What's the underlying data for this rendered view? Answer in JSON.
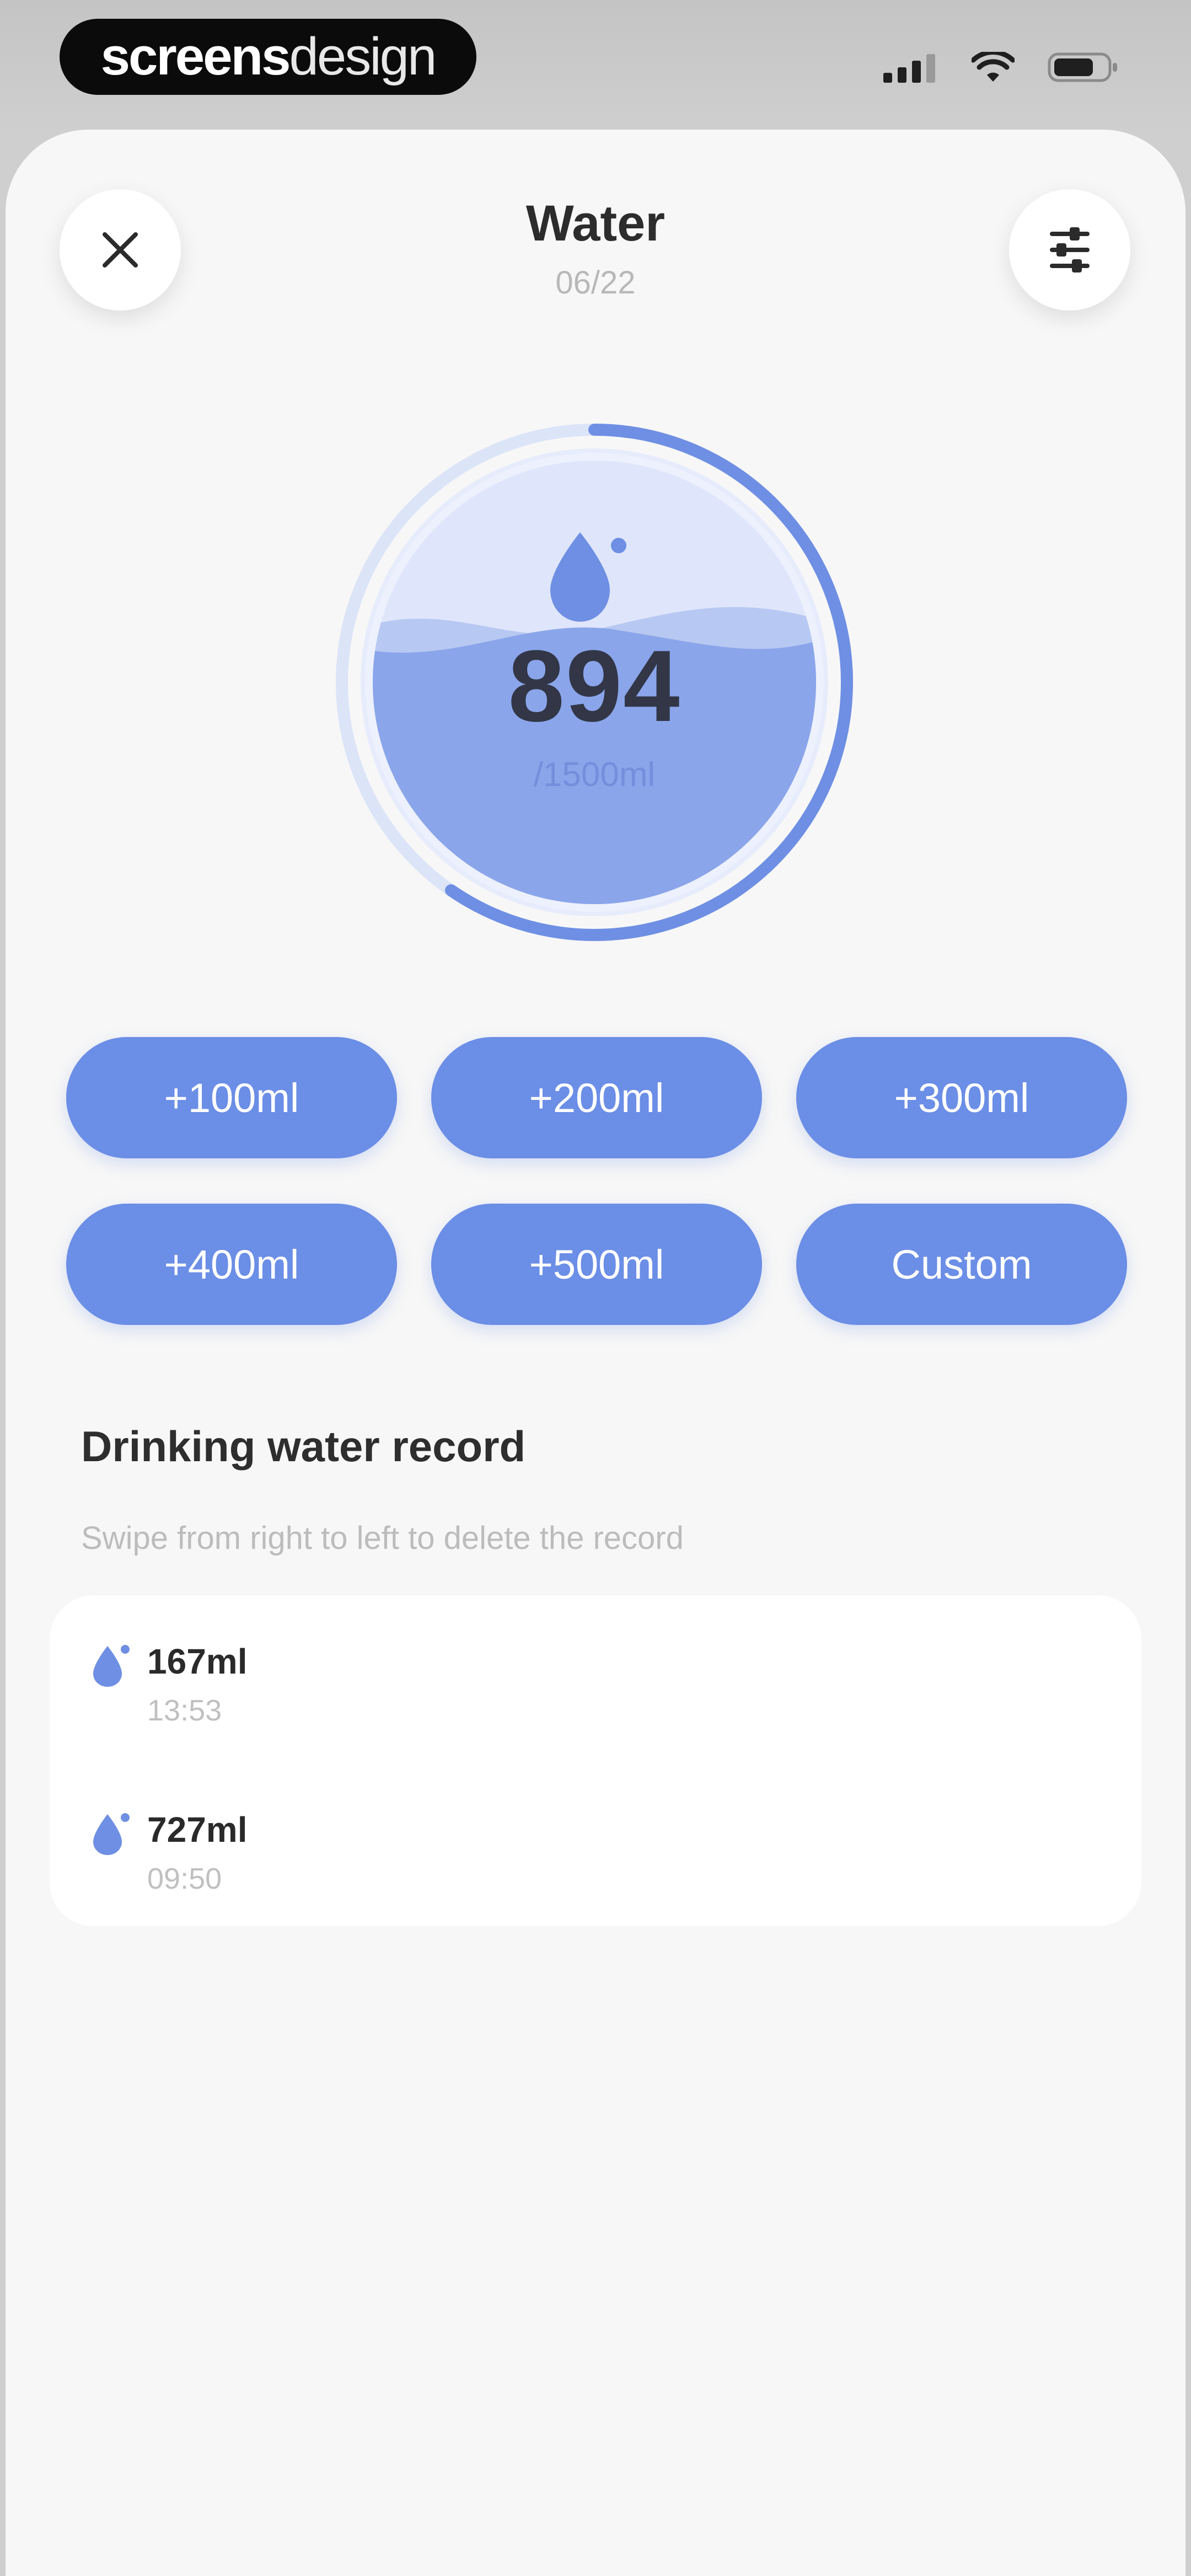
{
  "status_bar": {
    "watermark_bold": "screens",
    "watermark_light": "design",
    "signal_icon": "cellular-signal-icon",
    "wifi_icon": "wifi-icon",
    "battery_icon": "battery-icon"
  },
  "header": {
    "title": "Water",
    "date": "06/22",
    "close_icon": "close-icon",
    "settings_icon": "sliders-icon"
  },
  "gauge": {
    "value": "894",
    "goal_label": "/1500ml",
    "progress_fraction": 0.596,
    "icon": "water-drop-icon"
  },
  "quick_add": {
    "buttons": [
      {
        "label": "+100ml"
      },
      {
        "label": "+200ml"
      },
      {
        "label": "+300ml"
      },
      {
        "label": "+400ml"
      },
      {
        "label": "+500ml"
      },
      {
        "label": "Custom"
      }
    ]
  },
  "records": {
    "title": "Drinking water record",
    "hint": "Swipe from right to left to delete the record",
    "items": [
      {
        "amount": "167ml",
        "time": "13:53"
      },
      {
        "amount": "727ml",
        "time": "09:50"
      }
    ]
  },
  "colors": {
    "accent": "#6b8ee6",
    "water_dark": "#8aa5ea",
    "water_light": "#dfe6fb",
    "background": "#f7f7f7"
  }
}
